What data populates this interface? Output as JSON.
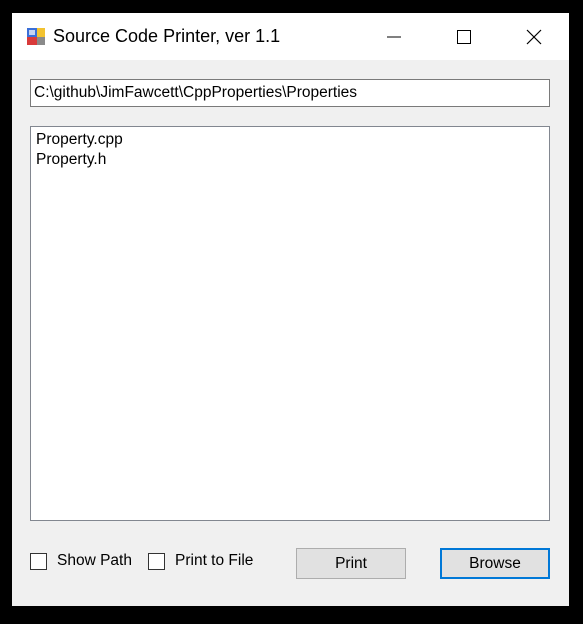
{
  "window": {
    "title": "Source Code Printer, ver 1.1",
    "icon": "app-icon"
  },
  "path": {
    "value": "C:\\github\\JimFawcett\\CppProperties\\Properties"
  },
  "files": [
    {
      "name": "Property.cpp"
    },
    {
      "name": "Property.h"
    }
  ],
  "options": {
    "show_path_label": "Show Path",
    "show_path_checked": false,
    "print_to_file_label": "Print to File",
    "print_to_file_checked": false
  },
  "buttons": {
    "print_label": "Print",
    "browse_label": "Browse"
  },
  "colors": {
    "focus_border": "#0078d7",
    "button_face": "#e1e1e1",
    "window_bg": "#f0f0f0"
  }
}
